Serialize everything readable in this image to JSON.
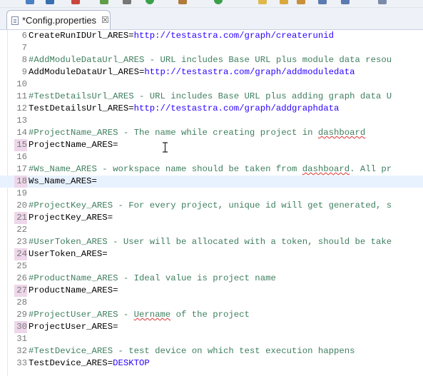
{
  "tab": {
    "label": "*Config.properties",
    "close": "☒"
  },
  "lines": [
    {
      "n": "6",
      "key": "CreateRunIDUrl_ARES=",
      "value": "http://testastra.com/graph/createrunid"
    },
    {
      "n": "7"
    },
    {
      "n": "8",
      "comment": "#AddModuleDataUrl_ARES - URL includes Base URL plus module data resou"
    },
    {
      "n": "9",
      "key": "AddModuleDataUrl_ARES=",
      "value": "http://testastra.com/graph/addmoduledata"
    },
    {
      "n": "10"
    },
    {
      "n": "11",
      "comment": "#TestDetailsUrl_ARES - URL includes Base URL plus adding graph data U"
    },
    {
      "n": "12",
      "key": "TestDetailsUrl_ARES=",
      "value": "http://testastra.com/graph/addgraphdata"
    },
    {
      "n": "13"
    },
    {
      "n": "14",
      "comment_pre": "#ProjectName_ARES - The name while creating project in ",
      "comment_sq": "dashboard",
      "comment_post": ""
    },
    {
      "n": "15",
      "key": "ProjectName_ARES=",
      "marker": true
    },
    {
      "n": "16"
    },
    {
      "n": "17",
      "comment_pre": "#Ws_Name_ARES - workspace name should be taken from ",
      "comment_sq": "dashboard",
      "comment_post": ". All pr"
    },
    {
      "n": "18",
      "key": "Ws_Name_ARES=",
      "marker": true,
      "current": true
    },
    {
      "n": "19"
    },
    {
      "n": "20",
      "comment": "#ProjectKey_ARES - For every project, unique id will get generated, s"
    },
    {
      "n": "21",
      "key": "ProjectKey_ARES=",
      "marker": true
    },
    {
      "n": "22"
    },
    {
      "n": "23",
      "comment": "#UserToken_ARES - User will be allocated with a token, should be take"
    },
    {
      "n": "24",
      "key": "UserToken_ARES=",
      "marker": true
    },
    {
      "n": "25"
    },
    {
      "n": "26",
      "comment": "#ProductName_ARES - Ideal value is project name"
    },
    {
      "n": "27",
      "key": "ProductName_ARES=",
      "marker": true
    },
    {
      "n": "28"
    },
    {
      "n": "29",
      "comment_pre": "#ProjectUser_ARES - ",
      "comment_sq": "Uername",
      "comment_post": " of the project"
    },
    {
      "n": "30",
      "key": "ProjectUser_ARES=",
      "marker": true
    },
    {
      "n": "31"
    },
    {
      "n": "32",
      "comment": "#TestDevice_ARES - test device on which test execution happens"
    },
    {
      "n": "33",
      "key": "TestDevice_ARES=",
      "value": "DESKTOP"
    }
  ]
}
